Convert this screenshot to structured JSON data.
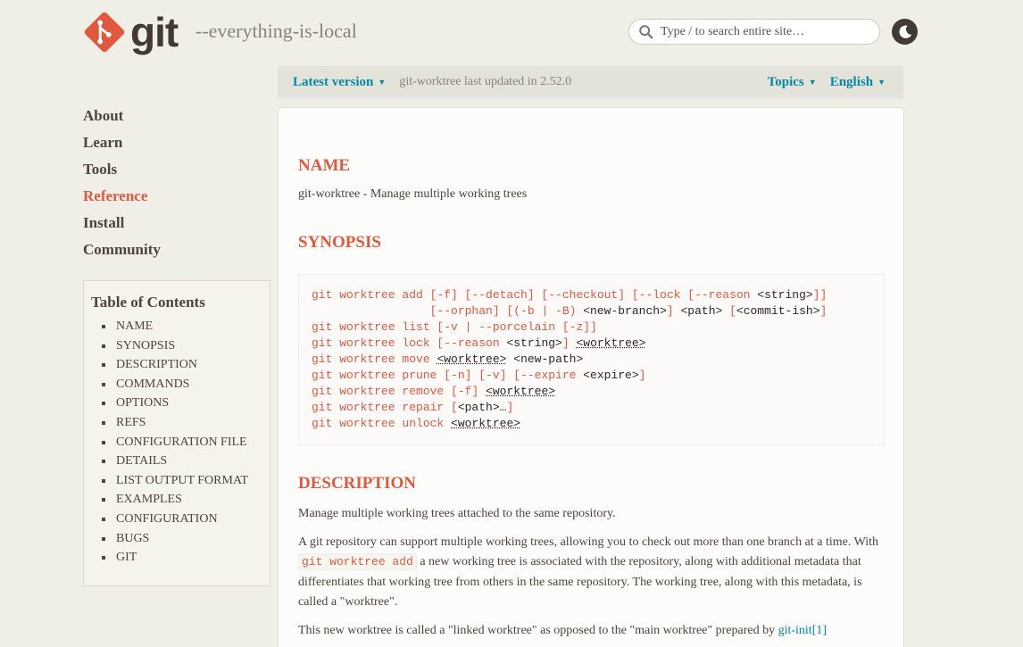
{
  "header": {
    "logo_text": "git",
    "tagline": "--everything-is-local",
    "search_placeholder": "Type / to search entire site…"
  },
  "version_bar": {
    "latest": "Latest version",
    "updated": "git-worktree last updated in 2.52.0",
    "topics": "Topics",
    "language": "English"
  },
  "sidenav": [
    "About",
    "Learn",
    "Tools",
    "Reference",
    "Install",
    "Community"
  ],
  "active_nav": "Reference",
  "toc": {
    "title": "Table of Contents",
    "items": [
      "NAME",
      "SYNOPSIS",
      "DESCRIPTION",
      "COMMANDS",
      "OPTIONS",
      "REFS",
      "CONFIGURATION FILE",
      "DETAILS",
      "LIST OUTPUT FORMAT",
      "EXAMPLES",
      "CONFIGURATION",
      "BUGS",
      "GIT"
    ]
  },
  "content": {
    "name_heading": "NAME",
    "name_text": "git-worktree - Manage multiple working trees",
    "synopsis_heading": "SYNOPSIS",
    "description_heading": "DESCRIPTION",
    "desc_p1": "Manage multiple working trees attached to the same repository.",
    "desc_p2_a": "A git repository can support multiple working trees, allowing you to check out more than one branch at a time. With ",
    "desc_p2_code": "git worktree add",
    "desc_p2_b": " a new working tree is associated with the repository, along with additional metadata that differentiates that working tree from others in the same repository. The working tree, along with this metadata, is called a \"worktree\".",
    "desc_p3_a": "This new worktree is called a \"linked worktree\" as opposed to the \"main worktree\" prepared by ",
    "desc_p3_link": "git-init[1]"
  },
  "colors": {
    "accent": "#e0583e",
    "link": "#0388a6",
    "background": "#f0efe7"
  }
}
